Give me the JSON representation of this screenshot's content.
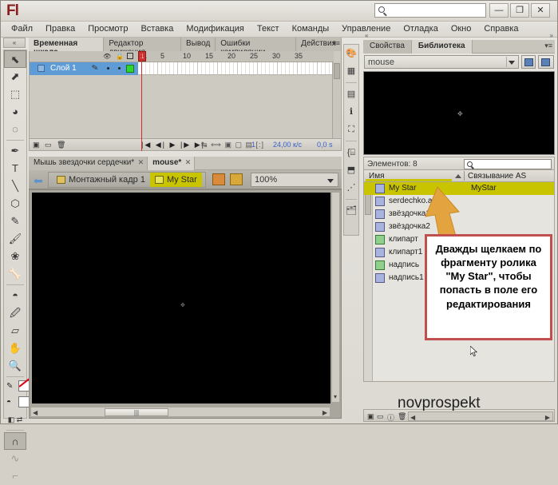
{
  "app": {
    "logo": "Fl",
    "workspace_number": "1",
    "window_buttons": {
      "minimize": "—",
      "maximize": "❐",
      "close": "✕"
    },
    "search_placeholder": ""
  },
  "menu": {
    "items": [
      "Файл",
      "Правка",
      "Просмотр",
      "Вставка",
      "Модификация",
      "Текст",
      "Команды",
      "Управление",
      "Отладка",
      "Окно",
      "Справка"
    ]
  },
  "timeline_panel": {
    "tabs": [
      {
        "label": "Временная шкала",
        "active": true
      },
      {
        "label": "Редактор движения",
        "active": false
      },
      {
        "label": "Вывод",
        "active": false
      },
      {
        "label": "Ошибки компиляции",
        "active": false
      },
      {
        "label": "Действия",
        "active": false
      }
    ],
    "menu_icon": "panel-menu-icon",
    "collapse_icon": "«",
    "layer": {
      "name": "Слой 1",
      "visible": true,
      "locked": false,
      "outline": false
    },
    "ruler_ticks": [
      "1",
      "5",
      "10",
      "15",
      "20",
      "25",
      "30",
      "35"
    ],
    "playhead_frame": "1",
    "footer": {
      "current_frame": "1",
      "fps": "24,00 к/с",
      "elapsed": "0,0 s"
    }
  },
  "tools": {
    "items": [
      {
        "name": "selection-tool",
        "glyph": "⬉",
        "selected": true
      },
      {
        "name": "subselection-tool",
        "glyph": "⬈",
        "selected": false
      },
      {
        "name": "free-transform-tool",
        "glyph": "⬚",
        "selected": false
      },
      {
        "name": "3d-rotation-tool",
        "glyph": "◕",
        "selected": false
      },
      {
        "name": "lasso-tool",
        "glyph": "◌",
        "selected": false
      },
      {
        "name": "pen-tool",
        "glyph": "✒",
        "selected": false
      },
      {
        "name": "text-tool",
        "glyph": "T",
        "selected": false
      },
      {
        "name": "line-tool",
        "glyph": "╲",
        "selected": false
      },
      {
        "name": "rectangle-tool",
        "glyph": "⬡",
        "selected": false
      },
      {
        "name": "pencil-tool",
        "glyph": "✎",
        "selected": false
      },
      {
        "name": "brush-tool",
        "glyph": "🖌",
        "selected": false
      },
      {
        "name": "deco-tool",
        "glyph": "❀",
        "selected": false
      },
      {
        "name": "bone-tool",
        "glyph": "🦴",
        "selected": false
      },
      {
        "name": "paint-bucket-tool",
        "glyph": "◓",
        "selected": false
      },
      {
        "name": "eyedropper-tool",
        "glyph": "🖉",
        "selected": false
      },
      {
        "name": "eraser-tool",
        "glyph": "▱",
        "selected": false
      },
      {
        "name": "hand-tool",
        "glyph": "✋",
        "selected": false
      },
      {
        "name": "zoom-tool",
        "glyph": "🔍",
        "selected": false
      }
    ],
    "stroke_color": "#ffffff",
    "fill_color": "#ffffff",
    "options": [
      {
        "name": "snap-to-objects-option",
        "glyph": "∩",
        "selected": true
      },
      {
        "name": "smooth-option",
        "glyph": "∿",
        "selected": false
      },
      {
        "name": "straighten-option",
        "glyph": "⌐",
        "selected": false
      }
    ]
  },
  "document_tabs": [
    {
      "label": "Мышь звездочки сердечки*",
      "active": false,
      "close": "✕"
    },
    {
      "label": "mouse*",
      "active": true,
      "close": "✕"
    }
  ],
  "edit_bar": {
    "back_icon": "back-arrow-icon",
    "breadcrumbs": [
      {
        "label": "Монтажный кадр 1",
        "current": false
      },
      {
        "label": "My Star",
        "current": true
      }
    ],
    "zoom_value": "100%"
  },
  "library_panel": {
    "tabs": [
      {
        "label": "Свойства",
        "active": false
      },
      {
        "label": "Библиотека",
        "active": true
      }
    ],
    "document_select": "mouse",
    "item_count_label": "Элементов: 8",
    "search_placeholder": "",
    "columns": {
      "name": "Имя",
      "linkage": "Связывание AS"
    },
    "items": [
      {
        "name": "My Star",
        "kind": "movie",
        "linkage": "MyStar",
        "selected": true
      },
      {
        "name": "serdechko.ai",
        "kind": "movie",
        "linkage": "",
        "selected": false
      },
      {
        "name": "звёздочка1",
        "kind": "movie",
        "linkage": "",
        "selected": false
      },
      {
        "name": "звёздочка2",
        "kind": "movie",
        "linkage": "",
        "selected": false
      },
      {
        "name": "клипарт",
        "kind": "graphic",
        "linkage": "",
        "selected": false
      },
      {
        "name": "клипарт1",
        "kind": "movie",
        "linkage": "",
        "selected": false
      },
      {
        "name": "надпись",
        "kind": "graphic",
        "linkage": "",
        "selected": false
      },
      {
        "name": "надпись1",
        "kind": "movie",
        "linkage": "",
        "selected": false
      }
    ]
  },
  "callout": {
    "text": "Дважды щелкаем по фрагменту ролика \"My Star\", чтобы попасть в поле его редактирования",
    "border_color": "#c0504d",
    "arrow_color": "#e0a040"
  },
  "watermark": "novprospekt",
  "colors": {
    "selection_yellow": "#c9c400",
    "layer_blue": "#5f9bd5",
    "playhead_red": "#d42a2a",
    "chrome": "#d4d0c8"
  }
}
